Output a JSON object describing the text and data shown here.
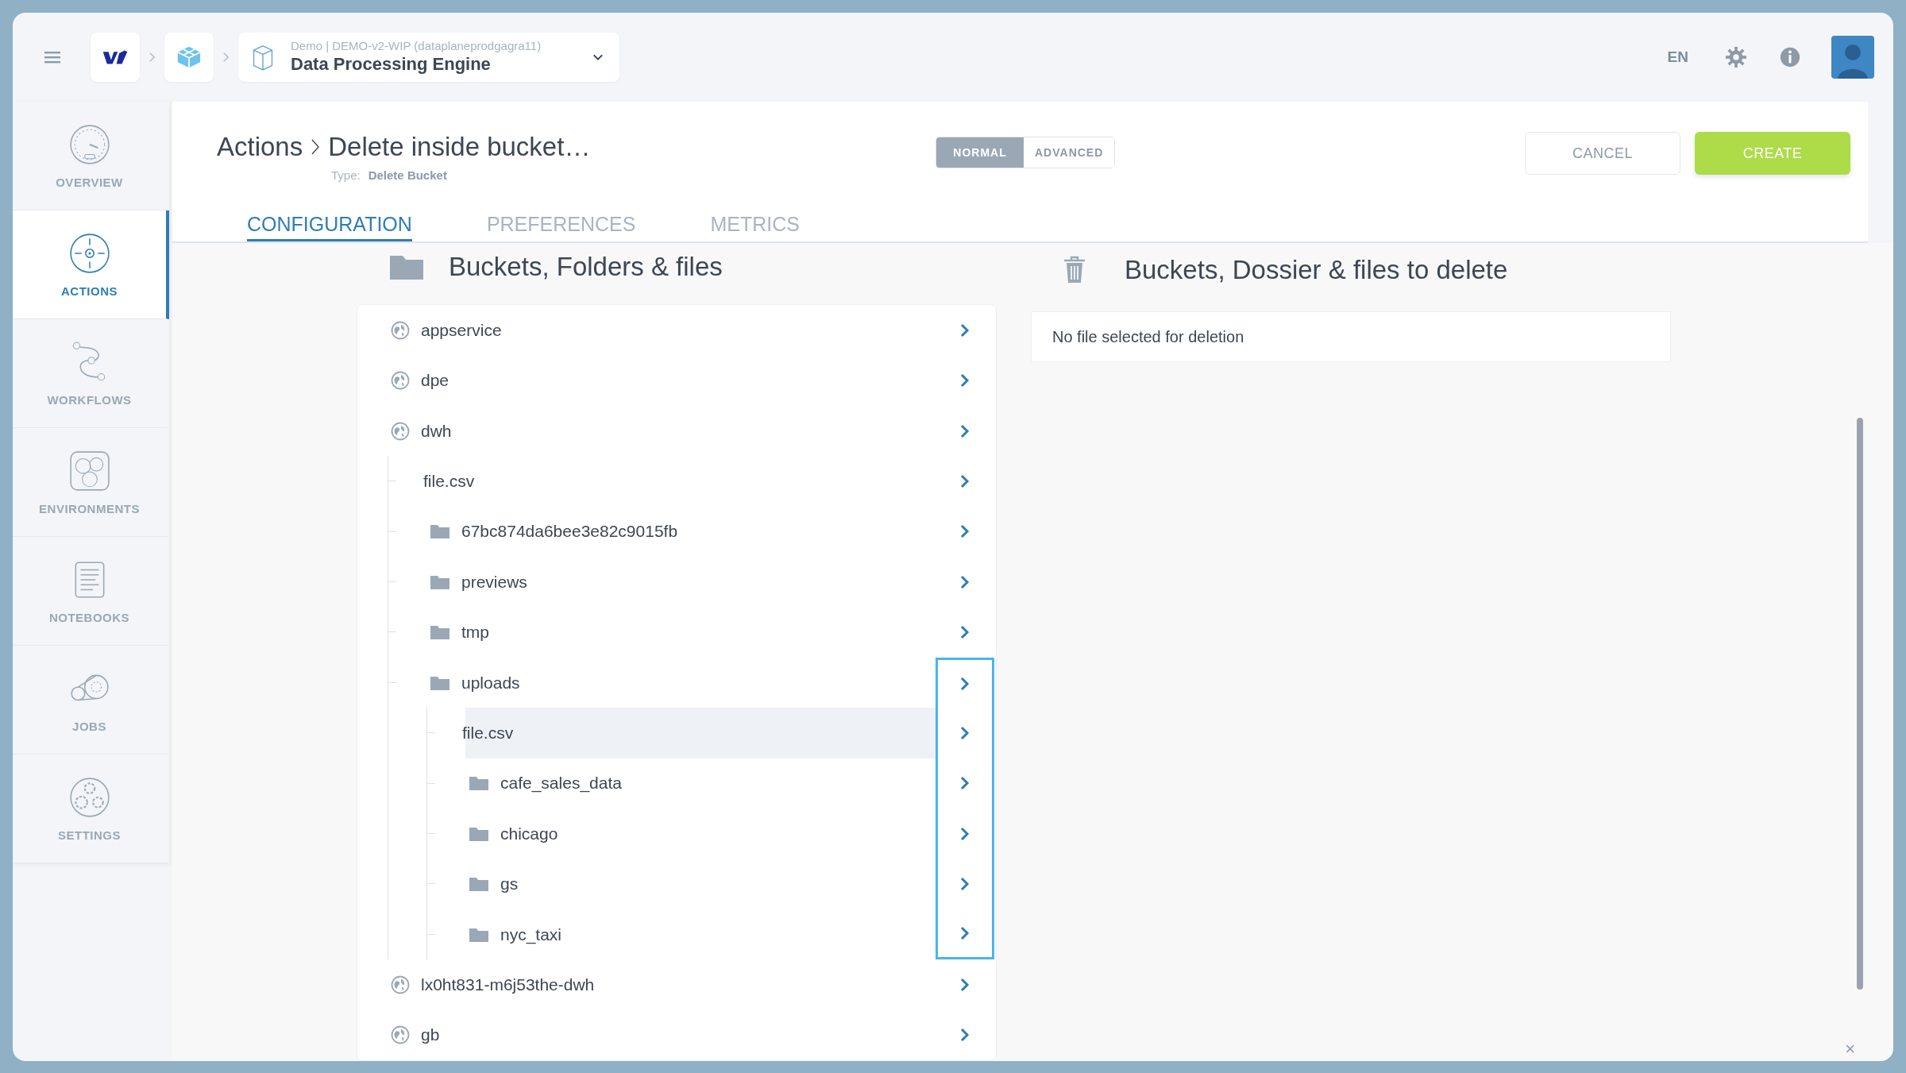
{
  "topbar": {
    "context": "Demo | DEMO-v2-WIP (dataplaneprodgagra11)",
    "title": "Data Processing Engine",
    "language": "EN"
  },
  "sidebar": {
    "items": [
      {
        "label": "OVERVIEW",
        "selected": false
      },
      {
        "label": "ACTIONS",
        "selected": true
      },
      {
        "label": "WORKFLOWS",
        "selected": false
      },
      {
        "label": "ENVIRONMENTS",
        "selected": false
      },
      {
        "label": "NOTEBOOKS",
        "selected": false
      },
      {
        "label": "JOBS",
        "selected": false
      },
      {
        "label": "SETTINGS",
        "selected": false
      }
    ]
  },
  "header": {
    "parent": "Actions",
    "title": "Delete inside bucket…",
    "type_label": "Type:",
    "type_value": "Delete Bucket",
    "modes": [
      {
        "label": "NORMAL",
        "selected": true
      },
      {
        "label": "ADVANCED",
        "selected": false
      }
    ],
    "buttons": [
      {
        "label": "CANCEL",
        "kind": "secondary"
      },
      {
        "label": "CREATE",
        "kind": "primary"
      }
    ]
  },
  "tabs": [
    {
      "label": "CONFIGURATION",
      "selected": true
    },
    {
      "label": "PREFERENCES",
      "selected": false
    },
    {
      "label": "METRICS",
      "selected": false
    }
  ],
  "source": {
    "title": "Buckets, Folders & files"
  },
  "tree": {
    "items": [
      {
        "name": "appservice",
        "kind": "bucket",
        "selected": false
      },
      {
        "name": "dpe",
        "kind": "bucket",
        "selected": false
      },
      {
        "name": "dwh",
        "kind": "bucket",
        "selected": false,
        "children": [
          {
            "name": "file.csv",
            "kind": "file",
            "selected": false
          },
          {
            "name": "67bc874da6bee3e82c9015fb",
            "kind": "folder",
            "selected": false
          },
          {
            "name": "previews",
            "kind": "folder",
            "selected": false
          },
          {
            "name": "tmp",
            "kind": "folder",
            "selected": false
          },
          {
            "name": "uploads",
            "kind": "folder",
            "selected": false,
            "outlined": true,
            "children": [
              {
                "name": "file.csv",
                "kind": "file",
                "selected": true
              },
              {
                "name": "cafe_sales_data",
                "kind": "folder",
                "selected": false
              },
              {
                "name": "chicago",
                "kind": "folder",
                "selected": false
              },
              {
                "name": "gs",
                "kind": "folder",
                "selected": false
              },
              {
                "name": "nyc_taxi",
                "kind": "folder",
                "selected": false
              }
            ]
          }
        ]
      },
      {
        "name": "lx0ht831-m6j53the-dwh",
        "kind": "bucket",
        "selected": false
      },
      {
        "name": "gb",
        "kind": "bucket",
        "selected": false
      }
    ]
  },
  "target": {
    "title": "Buckets, Dossier & files to delete",
    "empty_message": "No file selected for deletion"
  },
  "footer": {
    "close": "×"
  }
}
